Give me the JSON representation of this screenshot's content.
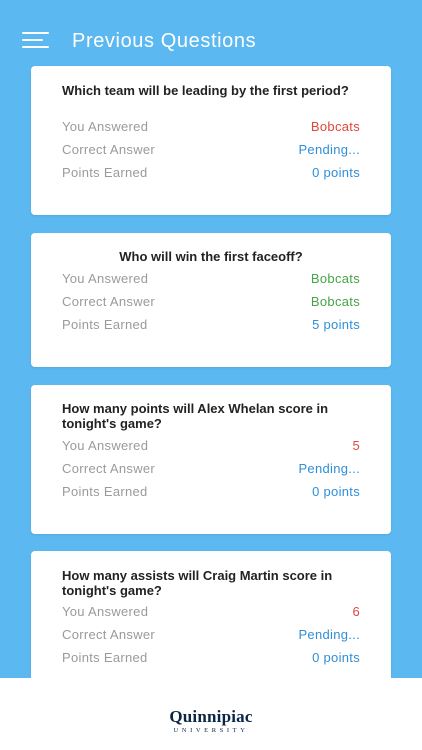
{
  "header": {
    "title": "Previous Questions",
    "menu_icon": "hamburger-menu-icon"
  },
  "labels": {
    "you_answered": "You Answered",
    "correct_answer": "Correct Answer",
    "points_earned": "Points Earned"
  },
  "questions": [
    {
      "question": "Which team will be leading by the first period?",
      "you_answered": "Bobcats",
      "correct_answer": "Pending...",
      "points_earned": "0 points"
    },
    {
      "question": "Who will win the first faceoff?",
      "you_answered": "Bobcats",
      "correct_answer": "Bobcats",
      "points_earned": "5 points"
    },
    {
      "question": "How many points will Alex Whelan score in tonight's game?",
      "you_answered": "5",
      "correct_answer": "Pending...",
      "points_earned": "0 points"
    },
    {
      "question": "How many assists will Craig Martin score in tonight's game?",
      "you_answered": "6",
      "correct_answer": "Pending...",
      "points_earned": "0 points"
    }
  ],
  "colors": {
    "background": "#5bb8f0",
    "incorrect": "#e0463c",
    "correct": "#47a447",
    "pending": "#2e8fd8"
  },
  "footer": {
    "logo_name": "Quinnipiac",
    "logo_sub": "UNIVERSITY"
  }
}
